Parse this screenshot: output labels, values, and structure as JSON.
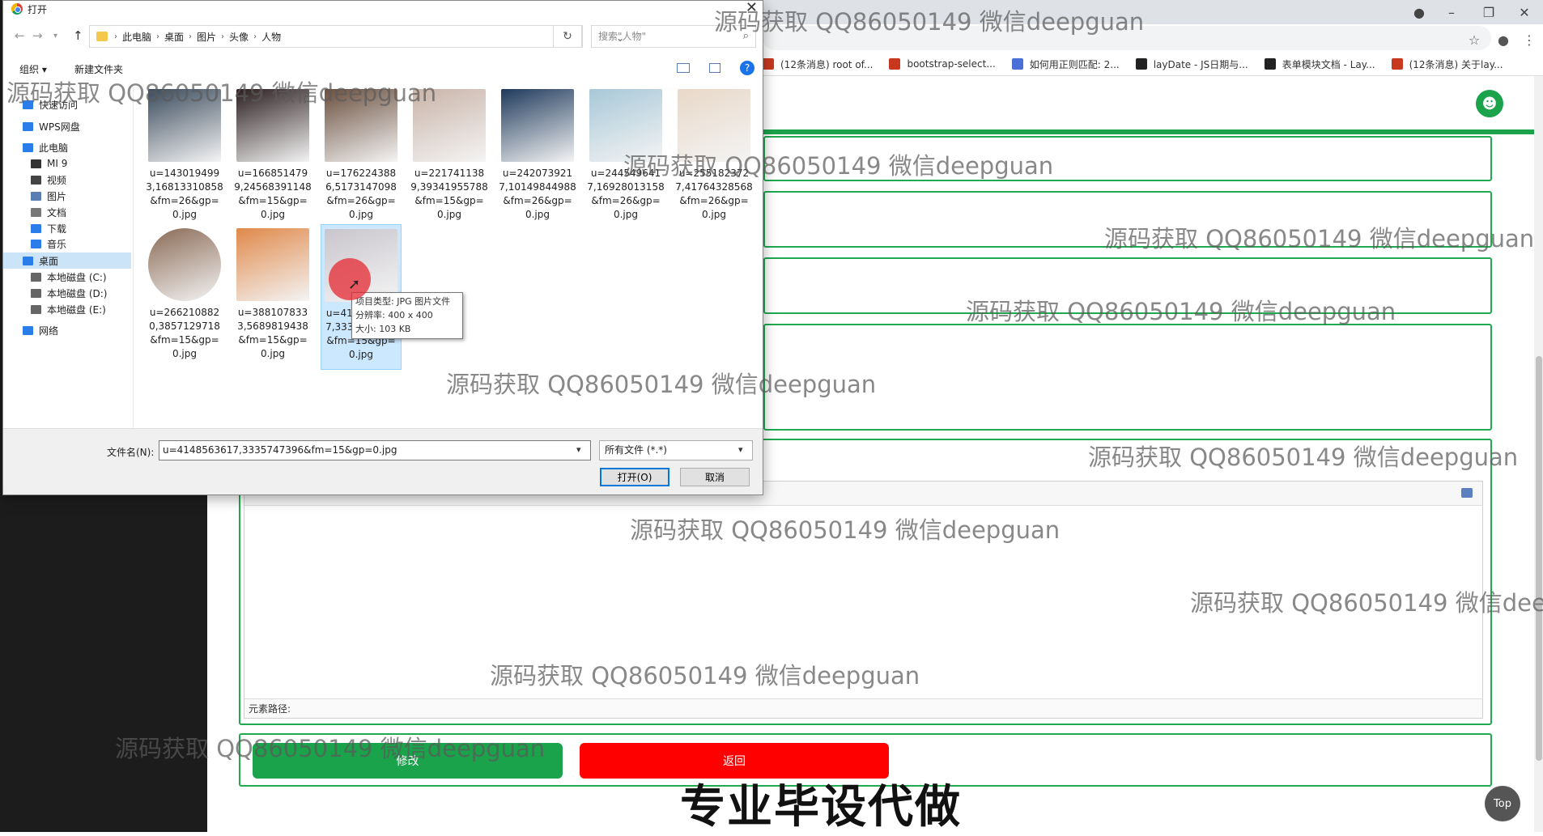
{
  "browser": {
    "bookmarks": [
      {
        "label": "(12条消息) root of...",
        "color": "#c8381f"
      },
      {
        "label": "bootstrap-select...",
        "color": "#c8381f"
      },
      {
        "label": "如何用正则匹配: 2...",
        "color": "#4a6fd8"
      },
      {
        "label": "layDate - JS日期与...",
        "color": "#222222"
      },
      {
        "label": "表单模块文档 - Lay...",
        "color": "#222222"
      },
      {
        "label": "(12条消息) 关于lay...",
        "color": "#c8381f"
      }
    ]
  },
  "dialog": {
    "title": "打开",
    "breadcrumb": [
      "此电脑",
      "桌面",
      "图片",
      "头像",
      "人物"
    ],
    "search_placeholder": "搜索\"人物\"",
    "cmd_organize": "组织 ▾",
    "cmd_new_folder": "新建文件夹",
    "nav_items": [
      {
        "label": "快速访问",
        "icon": "star-icon",
        "color": "#2b7de9"
      },
      {
        "label": "WPS网盘",
        "icon": "cloud-icon",
        "color": "#2b7de9"
      },
      {
        "label": "此电脑",
        "icon": "computer-icon",
        "color": "#2b7de9"
      },
      {
        "label": "MI 9",
        "icon": "phone-icon",
        "color": "#333333"
      },
      {
        "label": "视频",
        "icon": "video-icon",
        "color": "#444444"
      },
      {
        "label": "图片",
        "icon": "picture-icon",
        "color": "#5a7db4"
      },
      {
        "label": "文档",
        "icon": "document-icon",
        "color": "#777777"
      },
      {
        "label": "下载",
        "icon": "download-icon",
        "color": "#2b7de9"
      },
      {
        "label": "音乐",
        "icon": "music-icon",
        "color": "#2b7de9"
      },
      {
        "label": "桌面",
        "icon": "desktop-icon",
        "color": "#2b7de9"
      },
      {
        "label": "本地磁盘 (C:)",
        "icon": "drive-icon",
        "color": "#666666"
      },
      {
        "label": "本地磁盘 (D:)",
        "icon": "drive-icon",
        "color": "#666666"
      },
      {
        "label": "本地磁盘 (E:)",
        "icon": "drive-icon",
        "color": "#666666"
      },
      {
        "label": "网络",
        "icon": "network-icon",
        "color": "#2b7de9"
      }
    ],
    "files": [
      {
        "name": "u=1430194993,16813310858&fm=26&gp=0.jpg",
        "color": "#3a4a5c"
      },
      {
        "name": "u=1668514799,24568391148&fm=15&gp=0.jpg",
        "color": "#2a1d1e"
      },
      {
        "name": "u=1762243886,5173147098&fm=26&gp=0.jpg",
        "color": "#6a4f3e"
      },
      {
        "name": "u=2217411389,39341955788&fm=15&gp=0.jpg",
        "color": "#c9b4a8"
      },
      {
        "name": "u=2420739217,10149844988&fm=26&gp=0.jpg",
        "color": "#1f3a5c"
      },
      {
        "name": "u=2445496417,16928013158&fm=26&gp=0.jpg",
        "color": "#a8c8d8"
      },
      {
        "name": "u=2551823727,41764328568&fm=26&gp=0.jpg",
        "color": "#e8d8c8"
      },
      {
        "name": "u=2662108820,3857129718&fm=15&gp=0.jpg",
        "color": "#8a6a55"
      },
      {
        "name": "u=3881078333,5689819438&fm=15&gp=0.jpg",
        "color": "#e0894a"
      },
      {
        "name": "u=4148563617,3335747396&fm=15&gp=0.jpg",
        "color": "#c9c5cc"
      }
    ],
    "tooltip": [
      "项目类型: JPG 图片文件",
      "分辨率: 400 x 400",
      "大小: 103 KB"
    ],
    "filename_label": "文件名(N):",
    "filename_value": "u=4148563617,3335747396&fm=15&gp=0.jpg",
    "filetype_value": "所有文件 (*.*)",
    "open_button": "打开(O)",
    "cancel_button": "取消"
  },
  "page": {
    "editor_path_label": "元素路径:",
    "save_button": "修改",
    "back_button": "返回",
    "top_button": "Top",
    "accent_color": "#1aa34a",
    "danger_color": "#ff0000"
  },
  "overlay": {
    "watermark_text": "源码获取 QQ86050149 微信deepguan",
    "caption": "专业毕设代做"
  }
}
